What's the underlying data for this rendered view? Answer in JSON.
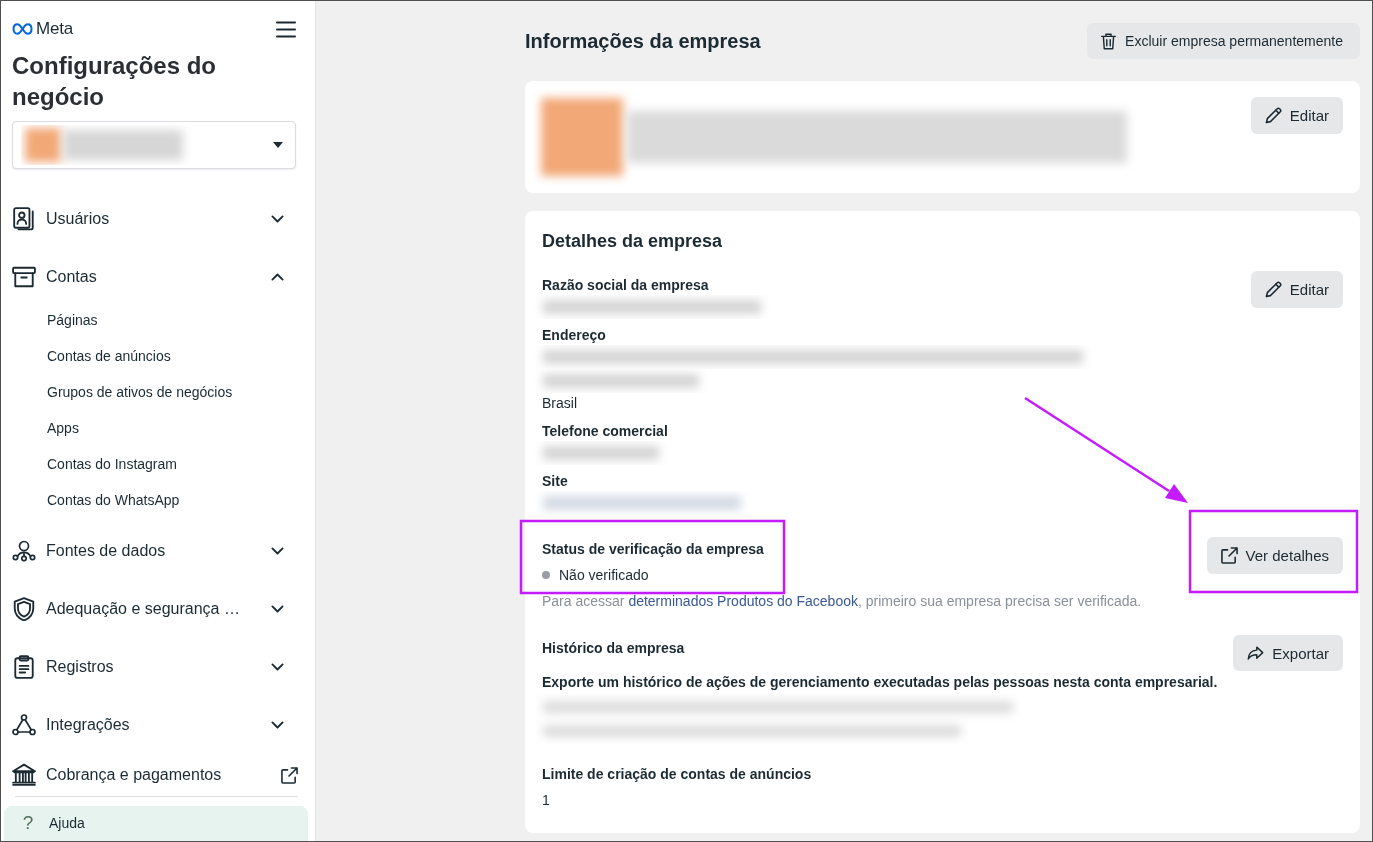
{
  "sidebar": {
    "logo": "Meta",
    "title": "Configurações do negócio",
    "nav": [
      {
        "label": "Usuários",
        "kind": "group",
        "expanded": false
      },
      {
        "label": "Contas",
        "kind": "group",
        "expanded": true,
        "children": [
          {
            "label": "Páginas"
          },
          {
            "label": "Contas de anúncios"
          },
          {
            "label": "Grupos de ativos de negócios"
          },
          {
            "label": "Apps"
          },
          {
            "label": "Contas do Instagram"
          },
          {
            "label": "Contas do WhatsApp"
          }
        ]
      },
      {
        "label": "Fontes de dados",
        "kind": "group",
        "expanded": false
      },
      {
        "label": "Adequação e segurança …",
        "kind": "group",
        "expanded": false
      },
      {
        "label": "Registros",
        "kind": "group",
        "expanded": false
      },
      {
        "label": "Integrações",
        "kind": "group",
        "expanded": false
      },
      {
        "label": "Cobrança e pagamentos",
        "kind": "external"
      }
    ],
    "help": {
      "icon": "?",
      "label": "Ajuda",
      "highlighted": true
    }
  },
  "header": {
    "title": "Informações da empresa",
    "delete_button": "Excluir empresa permanentemente"
  },
  "profile": {
    "edit_button": "Editar"
  },
  "details": {
    "title": "Detalhes da empresa",
    "edit_button": "Editar",
    "fields": [
      {
        "label": "Razão social da empresa",
        "kind": "blurred_text"
      },
      {
        "label": "Endereço",
        "kind": "blurred_address",
        "country": "Brasil"
      },
      {
        "label": "Telefone comercial",
        "kind": "blurred_text"
      },
      {
        "label": "Site",
        "kind": "blurred_link"
      }
    ],
    "verification": {
      "title": "Status de verificação da empresa",
      "verified": false,
      "status": "Não verificado",
      "note": {
        "before": "Para acessar ",
        "link": "determinados Produtos do Facebook",
        "after": ", primeiro sua empresa precisa ser verificada."
      },
      "button": "Ver detalhes"
    },
    "history": {
      "title": "Histórico da empresa",
      "description": "Exporte um histórico de ações de gerenciamento executadas pelas pessoas nesta conta empresarial.",
      "button": "Exportar"
    },
    "ad_account_limit": {
      "title": "Limite de criação de contas de anúncios",
      "value": "1"
    }
  }
}
